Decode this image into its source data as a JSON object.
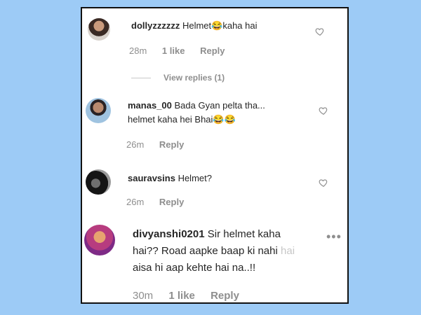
{
  "comments": [
    {
      "username": "dollyzzzzzz",
      "text": "Helmet😂kaha hai",
      "time": "28m",
      "likes": "1 like",
      "reply": "Reply"
    },
    {
      "username": "manas_00",
      "text_line1": "Bada Gyan pelta tha...",
      "text_line2": "helmet kaha hei Bhai😂😂",
      "time": "26m",
      "reply": "Reply"
    },
    {
      "username": "sauravsins",
      "text": "Helmet?",
      "time": "26m",
      "reply": "Reply"
    },
    {
      "username": "divyanshi0201",
      "text_line1": "Sir helmet kaha",
      "text_line2": "hai?? Road aapke baap ki nahi",
      "text_line2_fade": "hai",
      "text_line3": "aisa hi aap kehte hai na..!!",
      "time": "30m",
      "likes": "1 like",
      "reply": "Reply"
    }
  ],
  "view_replies": "View replies (1)",
  "icons": {
    "like": "heart-icon",
    "more": "more-options-icon"
  }
}
